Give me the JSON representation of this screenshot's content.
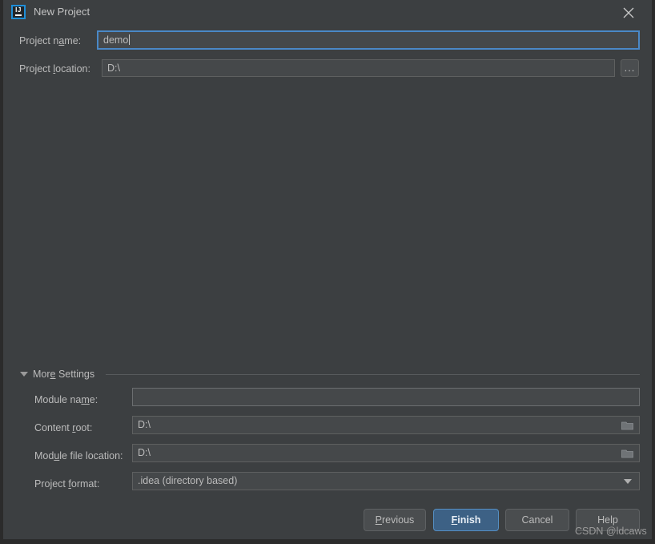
{
  "window": {
    "title": "New Project",
    "app_icon": "intellij-idea-icon",
    "icon_letters": "IJ",
    "close_icon": "close-icon",
    "bg_color": "#3c3f41",
    "accent_color": "#4a88c7"
  },
  "form": {
    "project_name": {
      "label_before": "Project n",
      "label_mnemonic": "a",
      "label_after": "me:",
      "value": "demo",
      "placeholder": ""
    },
    "project_location": {
      "label_before": "Project ",
      "label_mnemonic": "l",
      "label_after": "ocation:",
      "value": "D:\\",
      "placeholder": "",
      "browse_label": "..."
    }
  },
  "more_settings": {
    "toggle_label_before": "Mor",
    "toggle_label_mnemonic": "e",
    "toggle_label_after": " Settings",
    "expanded": true,
    "triangle_icon": "chevron-down-icon",
    "fields": {
      "module_name": {
        "label_before": "Module na",
        "label_mnemonic": "m",
        "label_after": "e:",
        "value": "",
        "placeholder": ""
      },
      "content_root": {
        "label_before": "Content ",
        "label_mnemonic": "r",
        "label_after": "oot:",
        "value": "D:\\",
        "browse_icon": "folder-icon"
      },
      "module_file_location": {
        "label_before": "Mod",
        "label_mnemonic": "u",
        "label_after": "le file location:",
        "value": "D:\\",
        "browse_icon": "folder-icon"
      },
      "project_format": {
        "label_before": "Project ",
        "label_mnemonic": "f",
        "label_after": "ormat:",
        "value": ".idea (directory based)",
        "dropdown_icon": "chevron-down-icon"
      }
    }
  },
  "buttons": {
    "previous": {
      "before": "",
      "mnemonic": "P",
      "after": "revious"
    },
    "finish": {
      "before": "",
      "mnemonic": "F",
      "after": "inish",
      "is_default": true
    },
    "cancel": {
      "before": "Cancel",
      "mnemonic": "",
      "after": ""
    },
    "help": {
      "before": "Help",
      "mnemonic": "",
      "after": ""
    }
  },
  "watermark": {
    "text": "CSDN @ldcaws"
  }
}
